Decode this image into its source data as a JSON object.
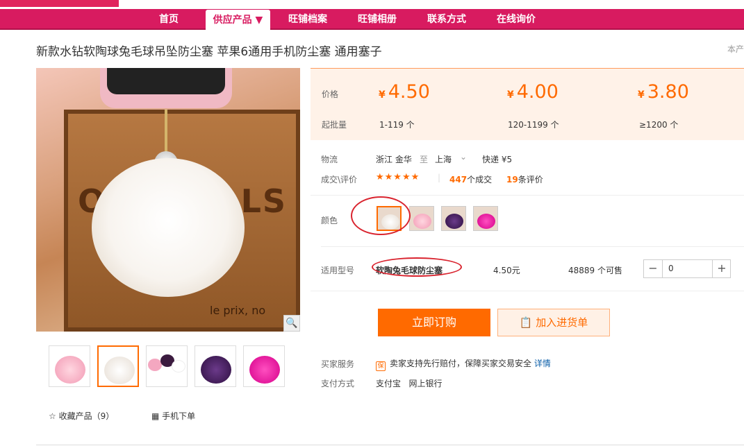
{
  "nav": {
    "items": [
      {
        "label": "首页"
      },
      {
        "label": "供应产品 ▼"
      },
      {
        "label": "旺铺档案"
      },
      {
        "label": "旺铺相册"
      },
      {
        "label": "联系方式"
      },
      {
        "label": "在线询价"
      }
    ]
  },
  "product": {
    "title": "新款水钻软陶球兔毛球吊坠防尘塞 苹果6通用手机防尘塞 通用塞子",
    "corner_text": "本产",
    "image_text": "ORIGINALS",
    "image_text2": "le prix, no"
  },
  "pricing": {
    "price_label": "价格",
    "moq_label": "起批量",
    "currency": "¥",
    "tiers": [
      {
        "price": "4.50",
        "range": "1-119 个"
      },
      {
        "price": "4.00",
        "range": "120-1199 个"
      },
      {
        "price": "3.80",
        "range": "≥1200 个"
      }
    ]
  },
  "logistics": {
    "label": "物流",
    "from": "浙江 金华",
    "to_word": "至",
    "dest": "上海",
    "shipping": "快递 ¥5"
  },
  "reviews": {
    "label": "成交\\评价",
    "stars": "★★★★★",
    "deals": "447",
    "deals_suffix": "个成交",
    "review_count": "19",
    "review_suffix": "条评价"
  },
  "color": {
    "label": "颜色"
  },
  "model": {
    "label": "适用型号",
    "name": "软陶兔毛球防尘塞",
    "price": "4.50元",
    "stock": "48889 个可售",
    "qty": "0",
    "minus": "−",
    "plus": "+"
  },
  "actions": {
    "buy": "立即订购",
    "cart": "加入进货单"
  },
  "services": {
    "buyer_label": "买家服务",
    "buyer_badge": "保",
    "buyer_text": "卖家支持先行赔付，保障买家交易安全",
    "buyer_link": "详情",
    "pay_label": "支付方式",
    "pay_options": "支付宝   网上银行"
  },
  "sidebar": {
    "fav": "收藏产品（9）",
    "mobile": "手机下单"
  },
  "colors": {
    "brand": "#d81b60",
    "accent": "#ff6a00"
  }
}
